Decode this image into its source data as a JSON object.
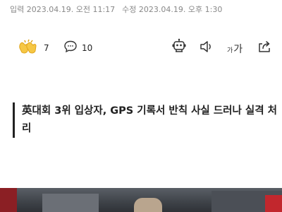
{
  "dateline": {
    "input_label": "입력",
    "input_time": "2023.04.19. 오전 11:17",
    "edit_label": "수정",
    "edit_time": "2023.04.19. 오후 1:30"
  },
  "reactions": {
    "like_count": "7",
    "comment_count": "10"
  },
  "toolbar": {
    "font_small": "가",
    "font_big": "가"
  },
  "headline": "英대회 3위 입상자, GPS 기록서 반칙 사실 드러나 실격 처리",
  "colors": {
    "accent_yellow": "#f6c744",
    "text": "#222222",
    "muted": "#888888"
  }
}
